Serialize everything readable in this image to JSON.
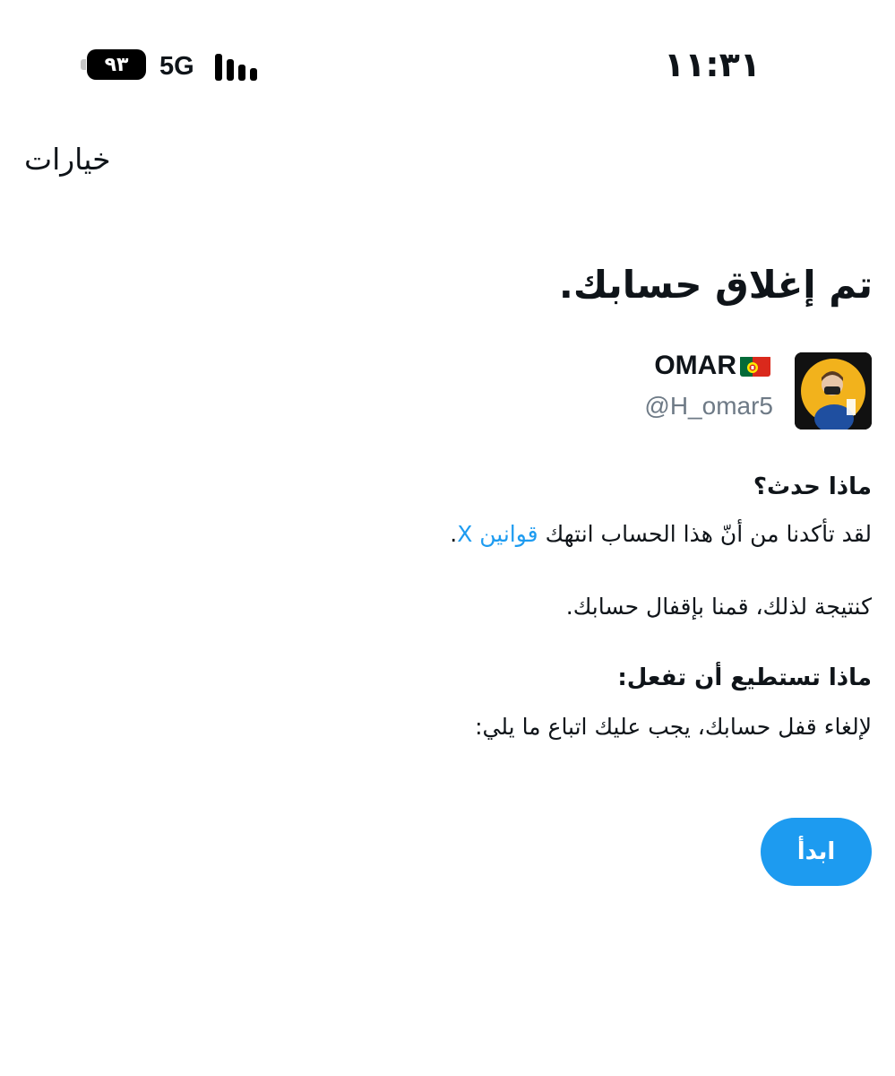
{
  "status_bar": {
    "time": "١١:٣١",
    "battery_level": "٩٣",
    "network": "5G",
    "signal_bars": 4
  },
  "header": {
    "options_label": "خيارات"
  },
  "main": {
    "title": "تم إغلاق حسابك.",
    "profile": {
      "name": "OMAR",
      "flag": "portugal-flag-icon",
      "handle": "@H_omar5"
    },
    "what_happened": {
      "heading": "ماذا حدث؟",
      "line1_prefix": "لقد تأكدنا من أنّ هذا الحساب انتهك ",
      "line1_link": "قوانين X",
      "line1_suffix": ".",
      "line2": "كنتيجة لذلك، قمنا بإقفال حسابك."
    },
    "what_you_can_do": {
      "heading": "ماذا تستطيع أن تفعل:",
      "text": "لإلغاء قفل حسابك، يجب عليك اتباع ما يلي:"
    },
    "start_button": "ابدأ"
  },
  "colors": {
    "accent": "#1d9bf0",
    "text": "#0f1419",
    "secondary_text": "#6e7a86"
  }
}
